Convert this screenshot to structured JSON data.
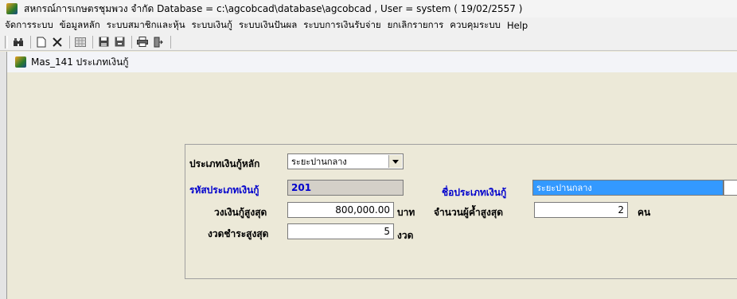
{
  "window": {
    "title": "สหกรณ์การเกษตรชุมพวง จำกัด Database = c:\\agcobcad\\database\\agcobcad , User = system ( 19/02/2557 )"
  },
  "menu": [
    "จัดการระบบ",
    "ข้อมูลหลัก",
    "ระบบสมาชิกและหุ้น",
    "ระบบเงินกู้",
    "ระบบเงินปันผล",
    "ระบบการเงินรับจ่าย",
    "ยกเลิกรายการ",
    "ควบคุมระบบ",
    "Help"
  ],
  "toolbar": {
    "icons": [
      "binoculars-icon",
      "new-document-icon",
      "delete-x-icon",
      "grid-icon",
      "save-icon",
      "save-as-icon",
      "print-icon",
      "exit-icon"
    ],
    "glyphs": [
      "🔍",
      "▯",
      "✕",
      "▦",
      "▣",
      "▤",
      "⎙",
      "⏏"
    ]
  },
  "child": {
    "title": "Mas_141 ประเภทเงินกู้"
  },
  "form": {
    "main_type_label": "ประเภทเงินกู้หลัก",
    "main_type_value": "ระยะปานกลาง",
    "code_label": "รหัสประเภทเงินกู้",
    "code_value": "201",
    "name_label": "ชื่อประเภทเงินกู้",
    "name_value": "ระยะปานกลาง",
    "max_amount_label": "วงเงินกู้สูงสุด",
    "max_amount_value": "800,000.00",
    "max_amount_unit": "บาท",
    "max_guarantor_label": "จำนวนผู้ค้ำสูงสุด",
    "max_guarantor_value": "2",
    "max_guarantor_unit": "คน",
    "max_installments_label": "งวดชำระสูงสุด",
    "max_installments_value": "5",
    "max_installments_unit": "งวด"
  },
  "colors": {
    "link_blue": "#0000cc",
    "selection": "#3399ff",
    "mdi_background": "#aba9a2"
  }
}
